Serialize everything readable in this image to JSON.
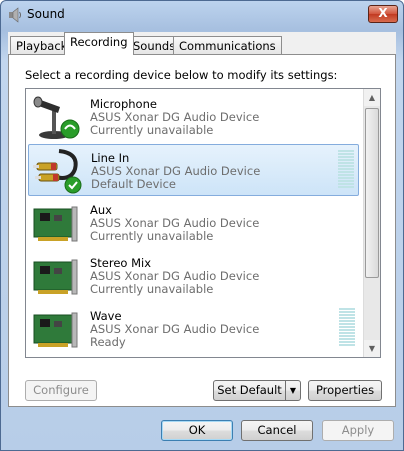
{
  "window": {
    "title": "Sound",
    "close_label": "X"
  },
  "tabs": [
    {
      "label": "Playback"
    },
    {
      "label": "Recording"
    },
    {
      "label": "Sounds"
    },
    {
      "label": "Communications"
    }
  ],
  "panel": {
    "instruction": "Select a recording device below to modify its settings:"
  },
  "devices": [
    {
      "name": "Microphone",
      "driver": "ASUS Xonar DG Audio Device",
      "status": "Currently unavailable",
      "icon": "microphone-icon"
    },
    {
      "name": "Line In",
      "driver": "ASUS Xonar DG Audio Device",
      "status": "Default Device",
      "icon": "line-in-icon"
    },
    {
      "name": "Aux",
      "driver": "ASUS Xonar DG Audio Device",
      "status": "Currently unavailable",
      "icon": "sound-card-icon"
    },
    {
      "name": "Stereo Mix",
      "driver": "ASUS Xonar DG Audio Device",
      "status": "Currently unavailable",
      "icon": "sound-card-icon"
    },
    {
      "name": "Wave",
      "driver": "ASUS Xonar DG Audio Device",
      "status": "Ready",
      "icon": "sound-card-icon"
    }
  ],
  "buttons": {
    "configure": "Configure",
    "set_default": "Set Default",
    "properties": "Properties",
    "ok": "OK",
    "cancel": "Cancel",
    "apply": "Apply"
  },
  "colors": {
    "selection": "#cde4f8",
    "status_check": "#2a9d2a",
    "meter": "#bfe3e6"
  }
}
